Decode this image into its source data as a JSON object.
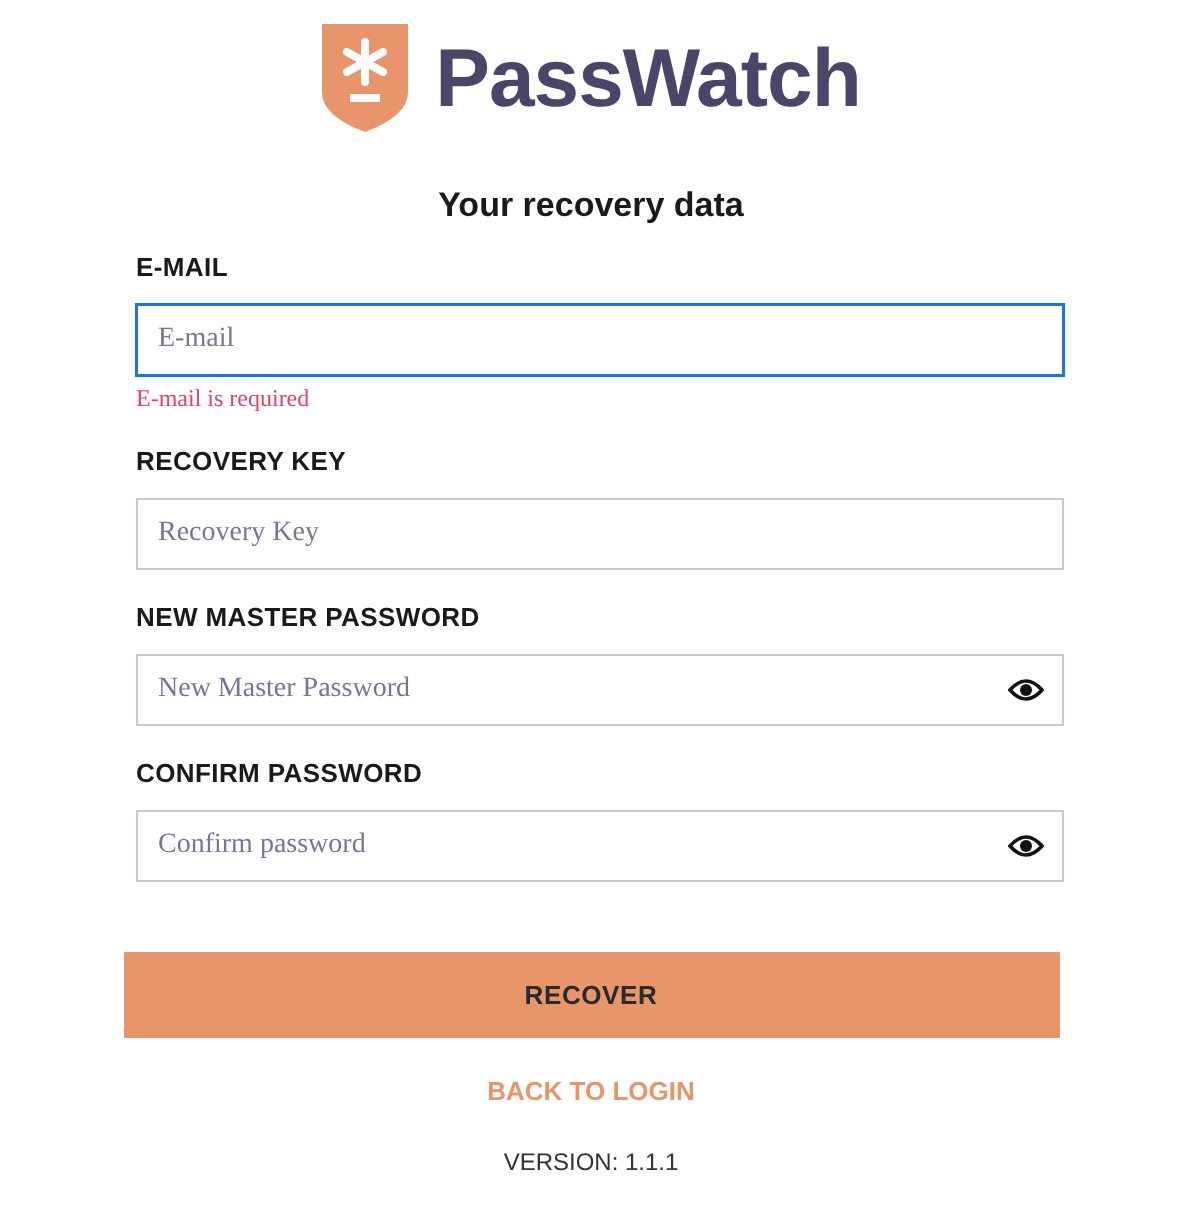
{
  "logo": {
    "text": "PassWatch"
  },
  "title": "Your recovery data",
  "fields": [
    {
      "kind": "text",
      "label": "E-MAIL",
      "placeholder": "E-mail",
      "focused": true,
      "error": "E-mail is required"
    },
    {
      "kind": "text",
      "label": "RECOVERY KEY",
      "placeholder": "Recovery Key",
      "focused": false
    },
    {
      "kind": "password",
      "label": "NEW MASTER PASSWORD",
      "placeholder": "New Master Password",
      "focused": false
    },
    {
      "kind": "password",
      "label": "CONFIRM PASSWORD",
      "placeholder": "Confirm password",
      "focused": false
    }
  ],
  "submit": "RECOVER",
  "back_link": "BACK TO LOGIN",
  "version": "VERSION: 1.1.1"
}
